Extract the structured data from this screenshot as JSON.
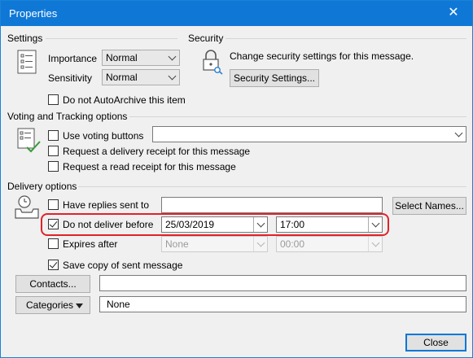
{
  "window": {
    "title": "Properties",
    "close_glyph": "✕"
  },
  "settings": {
    "heading": "Settings",
    "importance_label": "Importance",
    "importance_value": "Normal",
    "sensitivity_label": "Sensitivity",
    "sensitivity_value": "Normal",
    "no_autoarchive_label": "Do not AutoArchive this item",
    "no_autoarchive_checked": false
  },
  "security": {
    "heading": "Security",
    "description": "Change security settings for this message.",
    "button_label": "Security Settings..."
  },
  "voting": {
    "heading": "Voting and Tracking options",
    "use_voting_label": "Use voting buttons",
    "use_voting_checked": false,
    "voting_value": "",
    "delivery_receipt_label": "Request a delivery receipt for this message",
    "delivery_receipt_checked": false,
    "read_receipt_label": "Request a read receipt for this message",
    "read_receipt_checked": false
  },
  "delivery": {
    "heading": "Delivery options",
    "replies_label": "Have replies sent to",
    "replies_checked": false,
    "replies_value": "",
    "select_names_label": "Select Names...",
    "deliver_before_label": "Do not deliver before",
    "deliver_before_checked": true,
    "deliver_date": "25/03/2019",
    "deliver_time": "17:00",
    "expires_label": "Expires after",
    "expires_checked": false,
    "expires_date": "None",
    "expires_time": "00:00",
    "save_copy_label": "Save copy of sent message",
    "save_copy_checked": true
  },
  "contacts": {
    "button_label": "Contacts...",
    "value": ""
  },
  "categories": {
    "button_label": "Categories",
    "value": "None"
  },
  "footer": {
    "close_label": "Close"
  },
  "colors": {
    "titlebar": "#0f78d7",
    "highlight": "#e0222a",
    "accent": "#0078d7"
  },
  "icons": [
    "close-icon",
    "settings-list-icon",
    "security-lock-icon",
    "voting-check-icon",
    "delivery-tray-clock-icon",
    "dropdown-chevron-icon",
    "categories-arrow-icon"
  ]
}
